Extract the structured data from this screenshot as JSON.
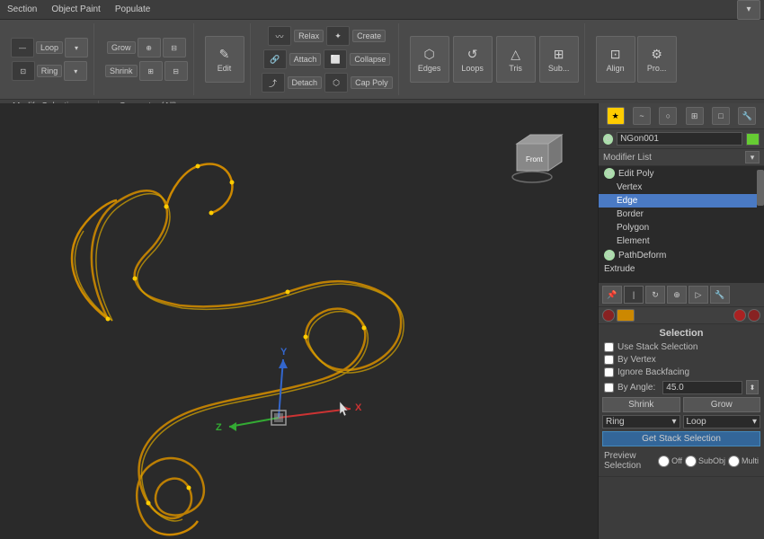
{
  "toolbar": {
    "top_items": [
      "Section",
      "Object Paint",
      "Populate",
      "▾"
    ],
    "buttons": {
      "loop": "Loop",
      "ring": "Ring",
      "grow": "Grow",
      "shrink": "Shrink",
      "relax": "Relax",
      "create": "Create",
      "attach": "Attach",
      "collapse": "Collapse",
      "detach": "Detach",
      "cap_poly": "Cap Poly",
      "edit": "Edit",
      "edges": "Edges",
      "loops": "Loops",
      "tris": "Tris",
      "sub": "Sub...",
      "align": "Align",
      "pro": "Pro..."
    },
    "tabs": {
      "modify_selection": "Modify Selection",
      "geometry_all": "Geometry (All)"
    }
  },
  "right_panel": {
    "object_name": "NGon001",
    "modifier_list_label": "Modifier List",
    "modifiers": [
      {
        "label": "Edit Poly",
        "level": 0,
        "has_icon": true
      },
      {
        "label": "Vertex",
        "level": 1,
        "active": false
      },
      {
        "label": "Edge",
        "level": 1,
        "active": true
      },
      {
        "label": "Border",
        "level": 1,
        "active": false
      },
      {
        "label": "Polygon",
        "level": 1,
        "active": false
      },
      {
        "label": "Element",
        "level": 1,
        "active": false
      },
      {
        "label": "PathDeform",
        "level": 0,
        "has_icon": true
      },
      {
        "label": "Extrude",
        "level": 0,
        "active": false
      }
    ],
    "selection": {
      "title": "Selection",
      "checkboxes": [
        {
          "label": "Use Stack Selection",
          "checked": false
        },
        {
          "label": "By Vertex",
          "checked": false
        },
        {
          "label": "Ignore Backfacing",
          "checked": false
        },
        {
          "label": "By Angle:",
          "checked": false
        }
      ],
      "angle_value": "45.0",
      "shrink_label": "Shrink",
      "grow_label": "Grow",
      "ring_label": "Ring",
      "loop_label": "Loop",
      "get_stack_label": "Get Stack Selection",
      "preview_label": "Preview Selection",
      "preview_options": [
        "Off",
        "SubObj",
        "Multi"
      ]
    }
  },
  "viewport": {
    "bg_color": "#2a2a2a"
  }
}
